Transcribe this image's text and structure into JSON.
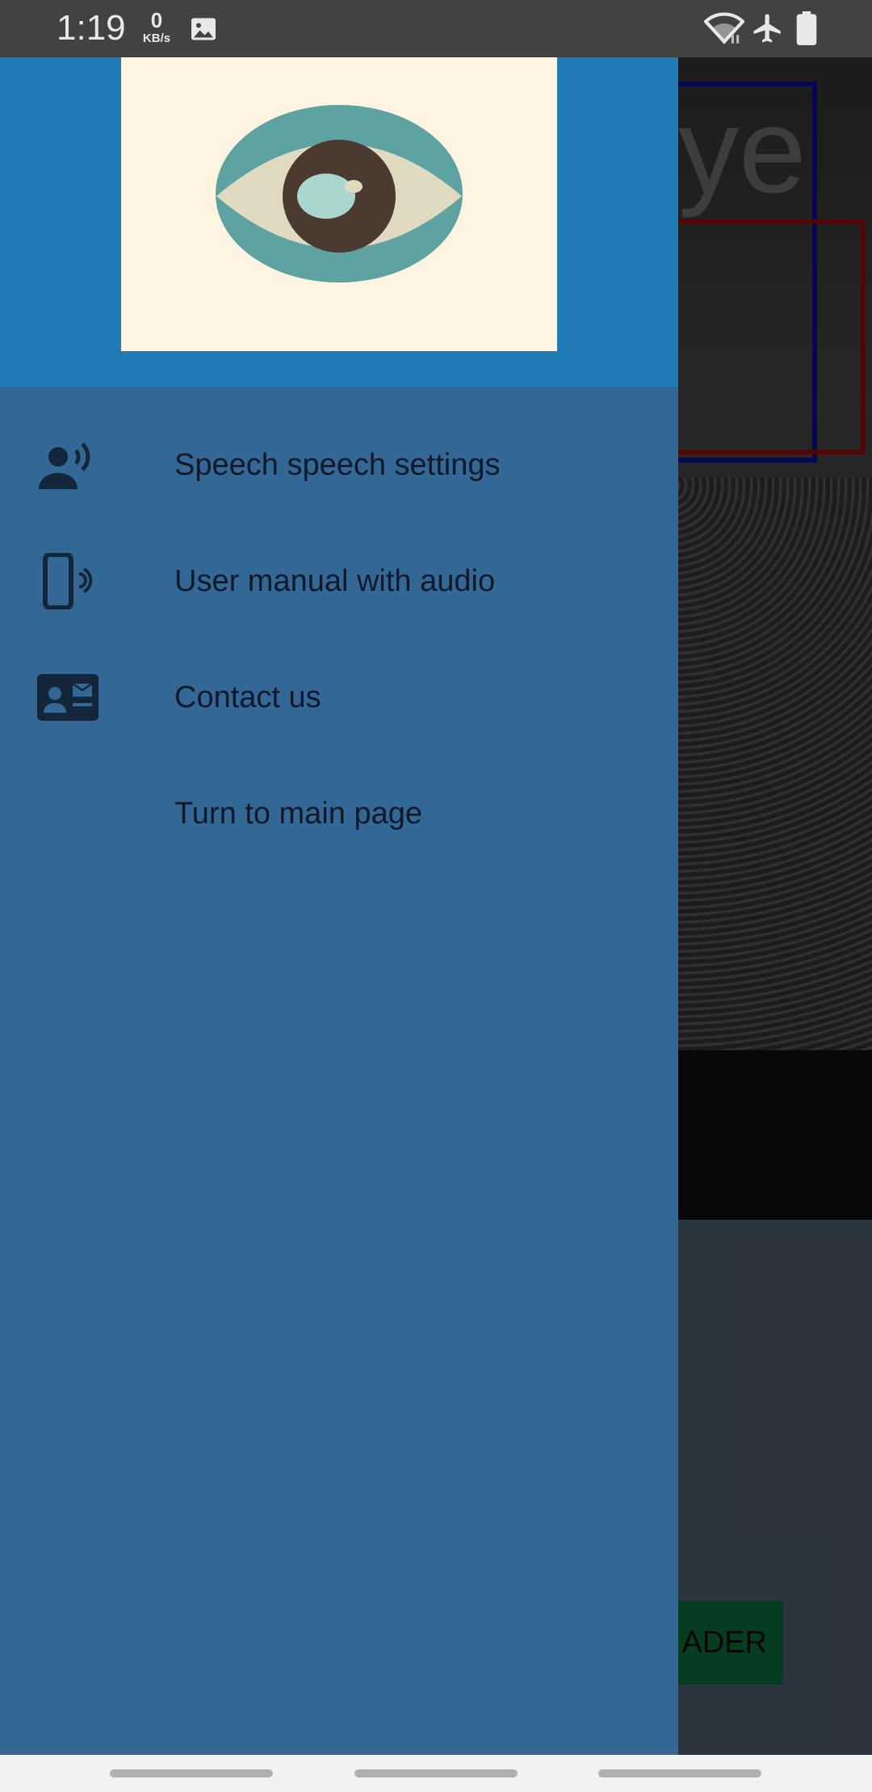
{
  "status_bar": {
    "time": "1:19",
    "net_speed_value": "0",
    "net_speed_unit": "KB/s",
    "icons": [
      "image-icon",
      "wifi-icon",
      "airplane-mode-icon",
      "battery-icon"
    ]
  },
  "background_app": {
    "title_fragment": "Eye",
    "button_fragment": "ADER"
  },
  "drawer": {
    "logo": "eye-logo",
    "items": [
      {
        "label": "Speech speech settings",
        "icon": "speaker-person-icon"
      },
      {
        "label": "User manual with audio",
        "icon": "phone-audio-icon"
      },
      {
        "label": "Contact us",
        "icon": "contact-card-icon"
      },
      {
        "label": "Turn to main page",
        "icon": ""
      }
    ]
  },
  "colors": {
    "drawer_bg": "#336795",
    "header_bg": "#207ab3",
    "logo_bg": "#fdf5e2",
    "label_text": "#0e1a2a",
    "icon_color": "#14263a"
  }
}
